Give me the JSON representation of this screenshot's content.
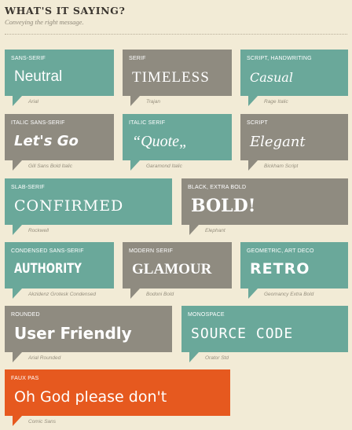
{
  "header": {
    "title": "WHAT'S IT SAYING?",
    "subtitle": "Conveying the right message."
  },
  "cards": [
    {
      "category": "SANS-SERIF",
      "sample": "Neutral",
      "font": "Arial",
      "color": "#6aa89a"
    },
    {
      "category": "SERIF",
      "sample": "TIMELESS",
      "font": "Trajan",
      "color": "#8f8b80"
    },
    {
      "category": "SCRIPT, HANDWRITING",
      "sample": "Casual",
      "font": "Rage Italic",
      "color": "#6aa89a"
    },
    {
      "category": "ITALIC SANS-SERIF",
      "sample": "Let's Go",
      "font": "Gill Sans Bold Italic",
      "color": "#8f8b80"
    },
    {
      "category": "ITALIC SERIF",
      "sample": "“Quote„",
      "font": "Garamond Italic",
      "color": "#6aa89a"
    },
    {
      "category": "SCRIPT",
      "sample": "Elegant",
      "font": "Bickham Script",
      "color": "#8f8b80"
    },
    {
      "category": "SLAB-SERIF",
      "sample": "CONFIRMED",
      "font": "Rockwell",
      "color": "#6aa89a"
    },
    {
      "category": "BLACK, EXTRA BOLD",
      "sample": "BOLD!",
      "font": "Elephant",
      "color": "#8f8b80"
    },
    {
      "category": "CONDENSED SANS-SERIF",
      "sample": "AUTHORITY",
      "font": "Akzidenz Grotesk Condensed",
      "color": "#6aa89a"
    },
    {
      "category": "MODERN SERIF",
      "sample": "GLAMOUR",
      "font": "Bodoni Bold",
      "color": "#8f8b80"
    },
    {
      "category": "GEOMETRIC, ART DECO",
      "sample": "RETRO",
      "font": "Geomancy Extra Bold",
      "color": "#6aa89a"
    },
    {
      "category": "ROUNDED",
      "sample": "User Friendly",
      "font": "Arial Rounded",
      "color": "#8f8b80"
    },
    {
      "category": "MONOSPACE",
      "sample": "SOURCE CODE",
      "font": "Orator Std",
      "color": "#6aa89a"
    },
    {
      "category": "FAUX PAS",
      "sample": "Oh God please don't",
      "font": "Comic Sans",
      "color": "#e6591f"
    }
  ]
}
